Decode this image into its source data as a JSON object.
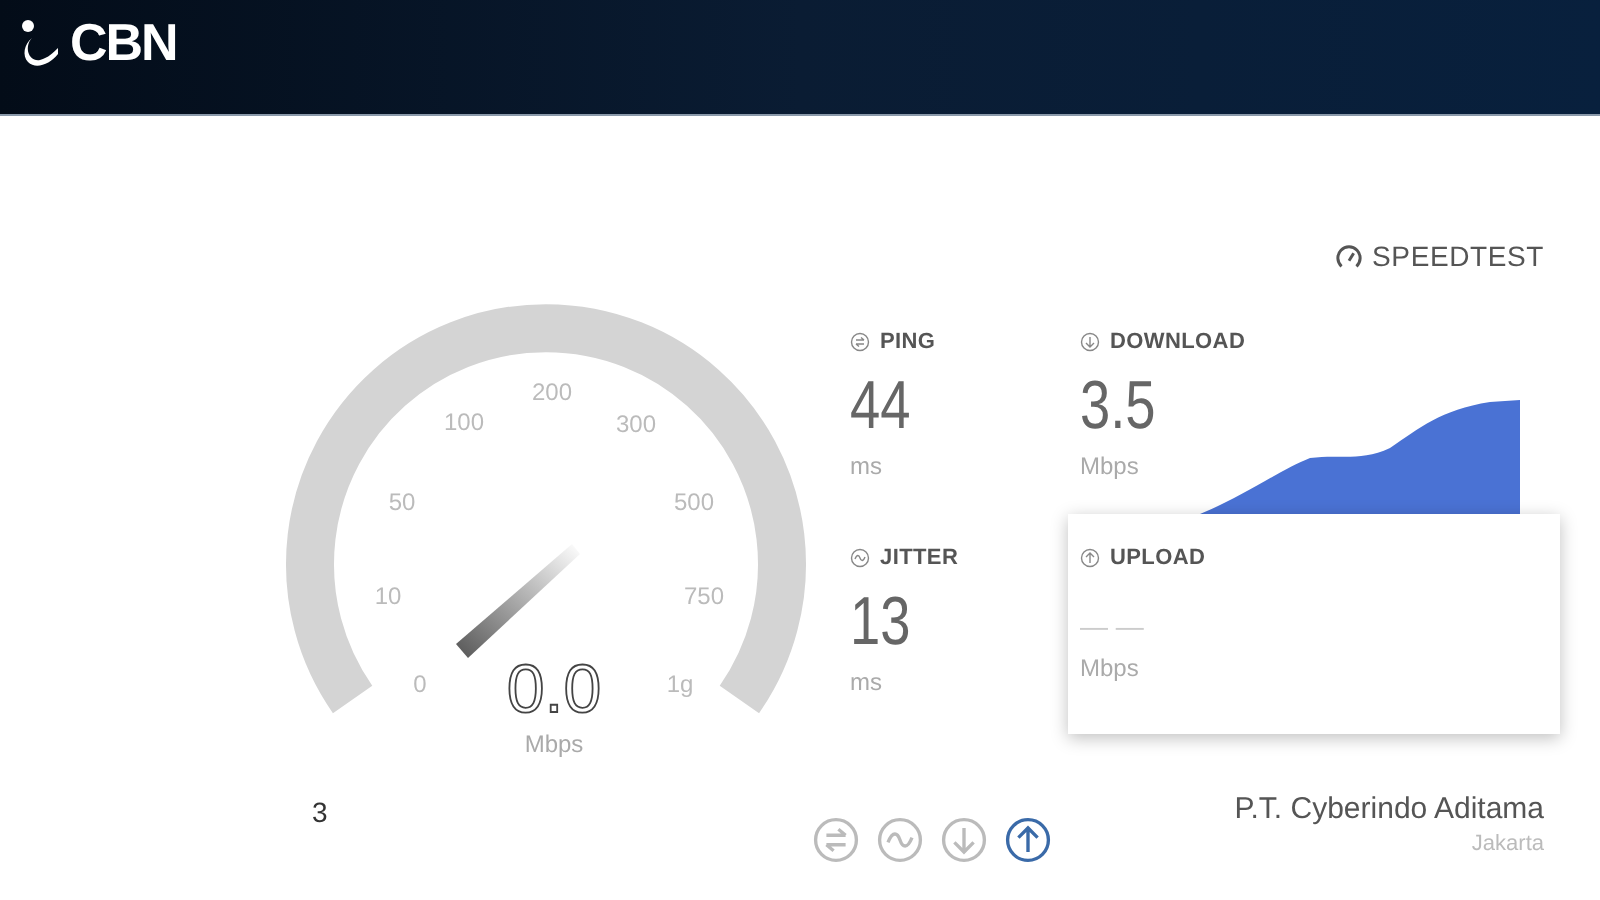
{
  "header": {
    "logo": "CBN"
  },
  "brand": {
    "label": "SPEEDTEST"
  },
  "gauge": {
    "labels": [
      "0",
      "10",
      "50",
      "100",
      "200",
      "300",
      "500",
      "750",
      "1g"
    ],
    "reading": "0.0",
    "unit": "Mbps"
  },
  "metrics": [
    {
      "kind": "ping",
      "label": "PING",
      "value": "44",
      "unit": "ms"
    },
    {
      "kind": "download",
      "label": "DOWNLOAD",
      "value": "3.5",
      "unit": "Mbps"
    },
    {
      "kind": "jitter",
      "label": "JITTER",
      "value": "13",
      "unit": "ms"
    },
    {
      "kind": "upload",
      "label": "UPLOAD",
      "value": "— —",
      "unit": "Mbps"
    }
  ],
  "steps": [
    {
      "kind": "ping",
      "selected": false
    },
    {
      "kind": "jitter",
      "selected": false
    },
    {
      "kind": "download",
      "selected": false
    },
    {
      "kind": "upload",
      "selected": true
    }
  ],
  "footer": {
    "server_count": "3",
    "provider": "P.T. Cyberindo Aditama",
    "location": "Jakarta"
  }
}
